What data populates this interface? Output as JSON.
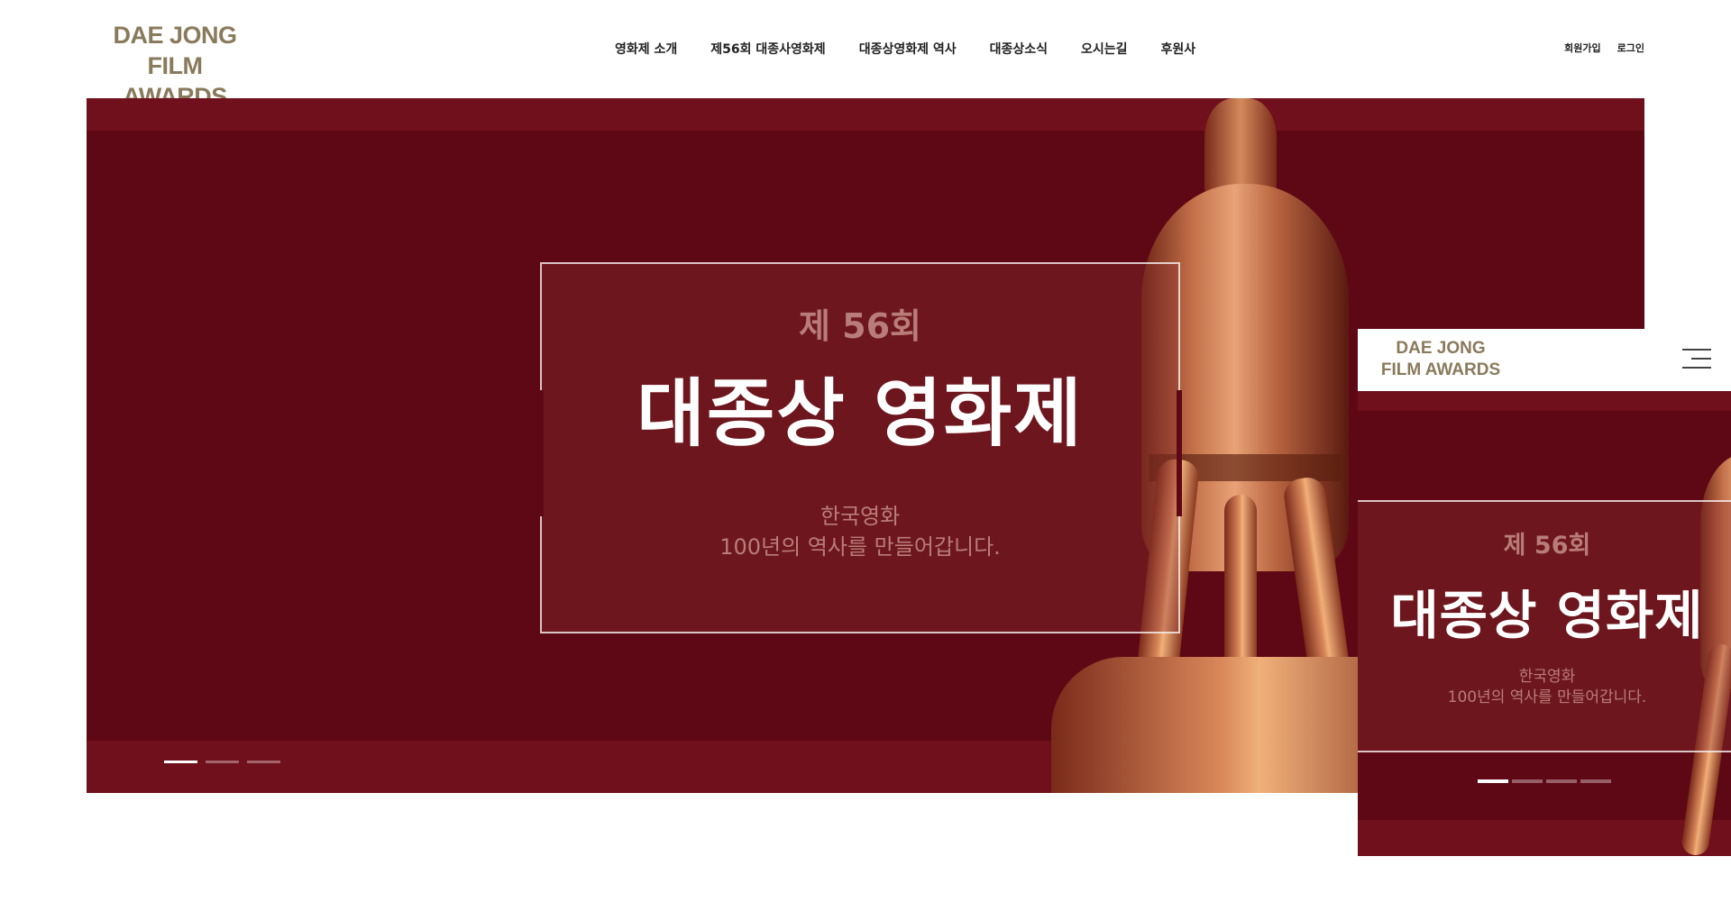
{
  "header": {
    "logo_line1": "DAE  JONG",
    "logo_line2": "FILM AWARDS",
    "nav": [
      "영화제 소개",
      "제56회 대종사영화제",
      "대종상영화제 역사",
      "대종상소식",
      "오시는길",
      "후원사"
    ],
    "util": {
      "signup": "회원가입",
      "login": "로그인"
    }
  },
  "hero": {
    "edition": "제 56회",
    "headline": "대종상 영화제",
    "sub_line1": "한국영화",
    "sub_line2": "100년의 역사를 만들어갑니다.",
    "slides": 3,
    "active_slide": 0
  },
  "mobile": {
    "logo_line1": "DAE  JONG",
    "logo_line2": "FILM AWARDS",
    "menu_icon": "hamburger-menu-icon",
    "edition": "제 56회",
    "headline": "대종상 영화제",
    "sub_line1": "한국영화",
    "sub_line2": "100년의 역사를 만들어갑니다.",
    "slides": 4,
    "active_slide": 0
  },
  "colors": {
    "brand_gold": "#8a7a5c",
    "hero_red": "#5f0815",
    "hero_band": "#70101c",
    "text_dark": "#222222"
  }
}
